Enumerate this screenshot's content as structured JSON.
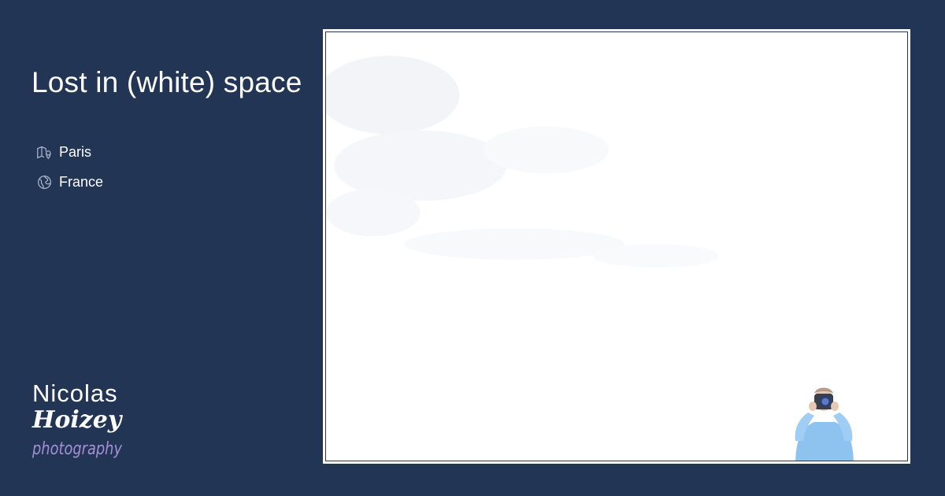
{
  "page": {
    "title": "Lost in (white) space",
    "background_color": "#223554"
  },
  "location": [
    {
      "icon": "map-icon",
      "label": "Paris"
    },
    {
      "icon": "globe-icon",
      "label": "France"
    }
  ],
  "logo": {
    "line1": "Nicolas",
    "line2": "Hoizey",
    "line3": "photography",
    "accent_color": "#a58fd6"
  },
  "photo": {
    "subject_icon": "photographer-figure"
  }
}
